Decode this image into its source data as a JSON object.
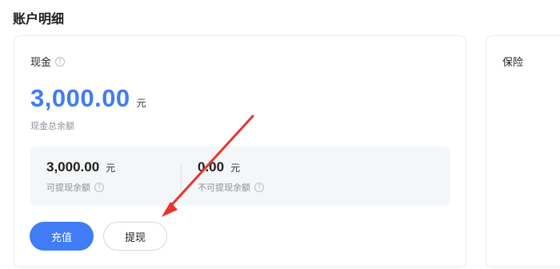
{
  "page": {
    "title": "账户明细"
  },
  "cash": {
    "title": "现金",
    "total_amount": "3,000.00",
    "currency": "元",
    "total_label": "现金总余额",
    "withdrawable": {
      "amount": "3,000.00",
      "currency": "元",
      "label": "可提现余额"
    },
    "non_withdrawable": {
      "amount": "0.00",
      "currency": "元",
      "label": "不可提现余额"
    },
    "recharge_label": "充值",
    "withdraw_label": "提现"
  },
  "insurance": {
    "title": "保险"
  },
  "colors": {
    "accent": "#3f7cf6",
    "annotation_arrow": "#e8342e"
  },
  "icons": {
    "help": "question-circle-icon",
    "annotation": "red-arrow-icon"
  }
}
